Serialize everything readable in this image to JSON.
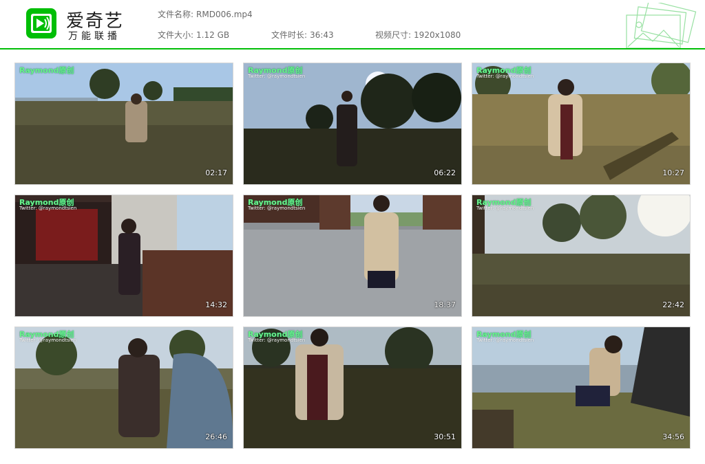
{
  "brand": {
    "name": "爱奇艺",
    "subtitle": "万能联播",
    "accent": "#00be06"
  },
  "file_info": {
    "name_label": "文件名称:",
    "name_value": "RMD006.mp4",
    "size_label": "文件大小:",
    "size_value": "1.12 GB",
    "duration_label": "文件时长:",
    "duration_value": "36:43",
    "dimension_label": "视频尺寸:",
    "dimension_value": "1920x1080"
  },
  "watermark": {
    "title": "Raymond原创",
    "twitter": "Twitter: @raymondtsien"
  },
  "thumbnails": [
    {
      "time": "02:17"
    },
    {
      "time": "06:22"
    },
    {
      "time": "10:27"
    },
    {
      "time": "14:32"
    },
    {
      "time": "18:37"
    },
    {
      "time": "22:42"
    },
    {
      "time": "26:46"
    },
    {
      "time": "30:51"
    },
    {
      "time": "34:56"
    }
  ]
}
